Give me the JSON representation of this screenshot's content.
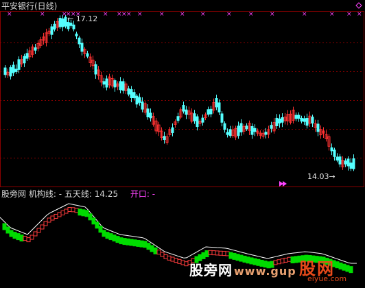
{
  "stock": {
    "title": "平安银行(日线)"
  },
  "price_panel": {
    "high_label": "17.12",
    "low_label": "14.03"
  },
  "indicator": {
    "prefix": "股旁网",
    "jigou_label": "机构线: -",
    "five_day_label": "五天线: 14.25",
    "open_label": "开口: -"
  },
  "watermark": {
    "text": "股旁网",
    "site": "www.gup",
    "logo": "股网",
    "url": "eiyue.com"
  },
  "colors": {
    "background": "#000000",
    "up_candle": "#ff3232",
    "down_candle": "#54ffff",
    "grid": "#8b0000",
    "marker": "#ff44ff",
    "band_green": "#00dc00",
    "band_red": "#ff3c3c",
    "band_line": "#ffffff"
  }
}
